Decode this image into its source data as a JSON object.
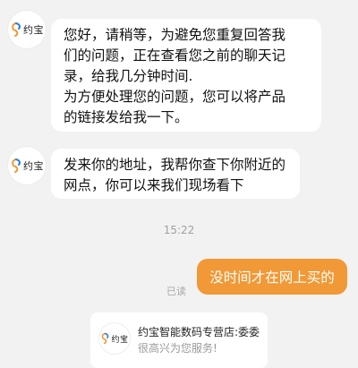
{
  "contact": {
    "avatar_text": "约宝"
  },
  "messages": [
    {
      "lines": [
        "您好，请稍等，为避免您重复回答我",
        "们的问题，正在查看您之前的聊天记",
        "录，给我几分钟时间.",
        "为方便处理您的问题，您可以将产品",
        "的链接发给我一下。"
      ]
    },
    {
      "lines": [
        "发来你的地址，我帮你查下你附近的",
        "网点，你可以来我们现场看下"
      ]
    }
  ],
  "timestamp": "15:22",
  "outgoing": {
    "text": "没时间才在网上买的",
    "status": "已读"
  },
  "shop_card": {
    "name": "约宝智能数码专营店:委委",
    "welcome": "很高兴为您服务!"
  },
  "colors": {
    "accent": "#f19936",
    "background": "#f2f2f2",
    "bubble": "#ffffff"
  }
}
